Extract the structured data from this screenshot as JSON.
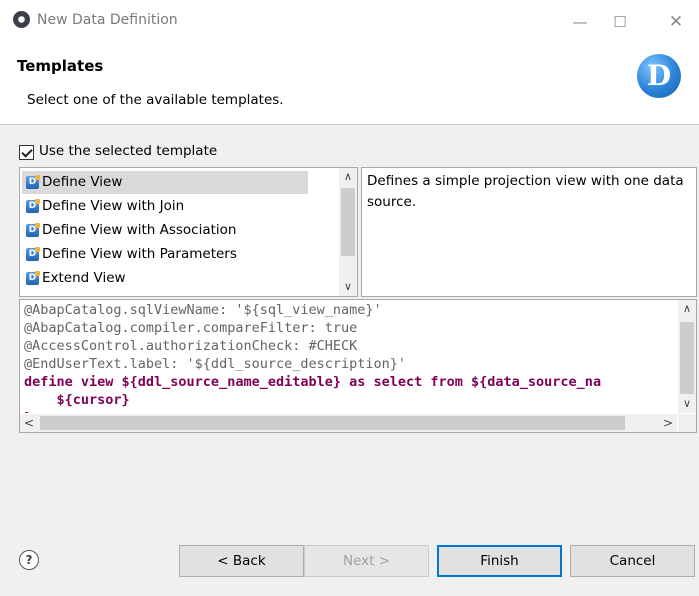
{
  "window": {
    "title": "New Data Definition",
    "minimize_glyph": "—",
    "maximize_glyph": "☐",
    "close_glyph": "✕"
  },
  "banner": {
    "title": "Templates",
    "subtitle": "Select one of the available templates.",
    "logo_letter": "D"
  },
  "template_checkbox": {
    "label": "Use the selected template",
    "checked": true
  },
  "templates": {
    "items": [
      {
        "label": "Define View",
        "selected": true
      },
      {
        "label": "Define View with Join",
        "selected": false
      },
      {
        "label": "Define View with Association",
        "selected": false
      },
      {
        "label": "Define View with Parameters",
        "selected": false
      },
      {
        "label": "Extend View",
        "selected": false
      }
    ],
    "icon_glyph": "D"
  },
  "description": "Defines a simple projection view with one data source.",
  "code": {
    "lines": [
      "@AbapCatalog.sqlViewName: '${sql_view_name}'",
      "@AbapCatalog.compiler.compareFilter: true",
      "@AccessControl.authorizationCheck: #CHECK",
      "@EndUserText.label: '${ddl_source_description}'",
      "define view ${ddl_source_name_editable} as select from ${data_source_na",
      "    ${cursor}",
      "}"
    ]
  },
  "scroll_glyphs": {
    "up": "∧",
    "down": "∨",
    "left": "<",
    "right": ">"
  },
  "footer": {
    "help_glyph": "?",
    "back_label": "< Back",
    "next_label": "Next >",
    "finish_label": "Finish",
    "cancel_label": "Cancel"
  },
  "colors": {
    "keyword": "#7f0055",
    "annotation": "#646464",
    "primary_border": "#0078d7",
    "selection": "#d9d9d9"
  }
}
